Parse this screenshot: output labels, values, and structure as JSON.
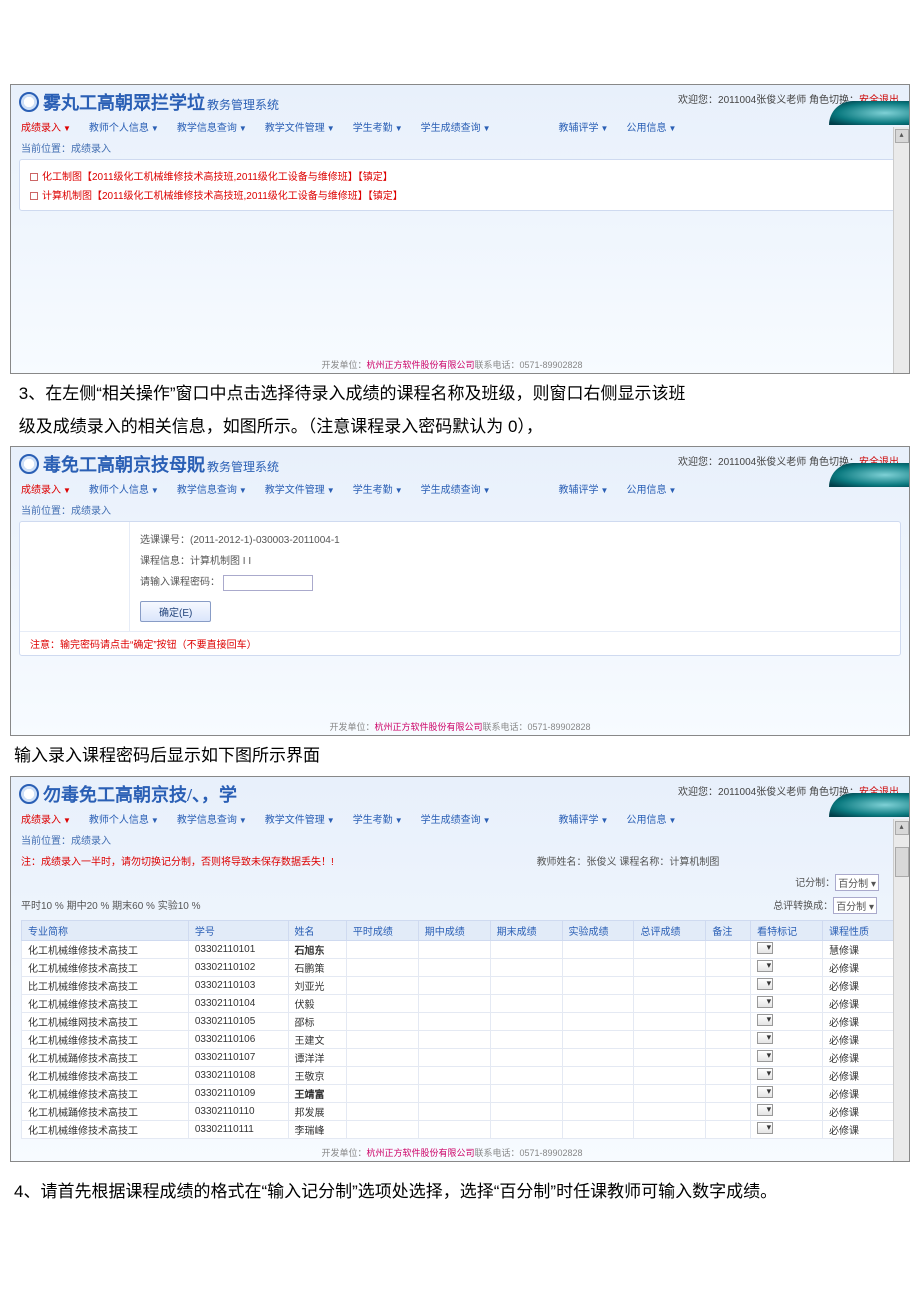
{
  "shot1": {
    "welcome": "欢迎您：2011004张俊义老师  角色切换：",
    "welcome_exit": "安全退出",
    "title": "雾丸工高朝眾拦学垃",
    "sub": "教务管理系统",
    "menu": [
      "成绩录入",
      "教师个人信息",
      "教学信息查询",
      "教学文件管理",
      "学生考勤",
      "学生成绩查询",
      "教辅评学",
      "公用信息"
    ],
    "crumb": "当前位置：成绩录入",
    "links": [
      "化工制图【2011级化工机械维修技术高技班,2011级化工设备与维修班】【镇定】",
      "计算机制图【2011级化工机械维修技术高技班,2011级化工设备与维修班】【镇定】"
    ],
    "footer_a": "开发单位：",
    "footer_b": "杭州正方软件股份有限公司",
    "footer_c": "联系电话：0571-89902828"
  },
  "para1a": "3、在左侧“相关操作”窗口中点击选择待录入成绩的课程名称及班级，则窗口右侧显示该班",
  "para1b": "级及成绩录入的相关信息，如图所示。（注意课程录入密码默认为 0），",
  "shot2": {
    "welcome": "欢迎您：2011004张俊义老师  角色切换：",
    "welcome_exit": "安全退出",
    "title": "毒免工高朝京技母貺",
    "sub": "教务管理系统",
    "menu": [
      "成绩录入",
      "教师个人信息",
      "教学信息查询",
      "教学文件管理",
      "学生考勤",
      "学生成绩查询",
      "教辅评学",
      "公用信息"
    ],
    "crumb": "当前位置：成绩录入",
    "course_no_label": "选课课号：(2011-2012-1)-030003-2011004-1",
    "course_info": "课程信息：计算机制图 I I",
    "pwd_label": "请输入课程密码：",
    "btn": "确定(E)",
    "warn": "注意：输完密码请点击“确定”按钮（不要直接回车）",
    "footer_a": "开发单位：",
    "footer_b": "杭州正方软件股份有限公司",
    "footer_c": "联系电话：0571-89902828"
  },
  "para2": "输入录入课程密码后显示如下图所示界面",
  "shot3": {
    "welcome": "欢迎您：2011004张俊义老师  角色切换：",
    "welcome_exit": "安全退出",
    "title": "勿毒免工高朝京技/、，学",
    "menu": [
      "成绩录入",
      "教师个人信息",
      "教学信息查询",
      "教学文件管理",
      "学生考勤",
      "学生成绩查询",
      "教辅评学",
      "公用信息"
    ],
    "crumb": "当前位置：成绩录入",
    "note_red": "注：成绩录入一半时，请勿切换记分制，否则将导致未保存数据丢失！!",
    "note_mid": "教师姓名：张俊义 课程名称：计算机制图",
    "ratio": "平时10 % 期中20 % 期末60 % 实验10 %",
    "sel1_label": "记分制：",
    "sel1_val": "百分制",
    "sel2_label": "总评转换成：",
    "sel2_val": "百分制",
    "headers": [
      "专业简称",
      "学号",
      "姓名",
      "平时成绩",
      "期中成绩",
      "期末成绩",
      "实验成绩",
      "总评成绩",
      "备注",
      "看特标记",
      "课程性质"
    ],
    "rows": [
      {
        "maj": "化工机械维修技术高技工",
        "sid": "03302110101",
        "name": "石旭东",
        "type": "慧修课"
      },
      {
        "maj": "化工机械维修技术高技工",
        "sid": "03302110102",
        "name": "石鹏策",
        "type": "必修课"
      },
      {
        "maj": "比工机械维修技术高技工",
        "sid": "03302110103",
        "name": "刘亚光",
        "type": "必修课"
      },
      {
        "maj": "化工机械维修技术高技工",
        "sid": "03302110104",
        "name": "伏毅",
        "type": "必修课"
      },
      {
        "maj": "化工机械维网技术高技工",
        "sid": "03302110105",
        "name": "邵标",
        "type": "必修课"
      },
      {
        "maj": "化工机械维修技术高技工",
        "sid": "03302110106",
        "name": "王建文",
        "type": "必修课"
      },
      {
        "maj": "化工机械踊修技术高技工",
        "sid": "03302110107",
        "name": "谭洋洋",
        "type": "必修课"
      },
      {
        "maj": "化工机械维修技术高技工",
        "sid": "03302110108",
        "name": "王敬京",
        "type": "必修课"
      },
      {
        "maj": "化工机械维修技术高技工",
        "sid": "03302110109",
        "name": "王靖富",
        "type": "必修课"
      },
      {
        "maj": "化工机械踊修技术高技工",
        "sid": "03302110110",
        "name": "邦发展",
        "type": "必修课"
      },
      {
        "maj": "化工机械维修技术高技工",
        "sid": "03302110111",
        "name": "李瑞峰",
        "type": "必修课"
      }
    ],
    "footer_a": "开发单位：",
    "footer_b": "杭州正方软件股份有限公司",
    "footer_c": "联系电话：0571-89902828"
  },
  "para3": "4、请首先根据课程成绩的格式在“输入记分制”选项处选择，选择“百分制”时任课教师可输入数字成绩。"
}
